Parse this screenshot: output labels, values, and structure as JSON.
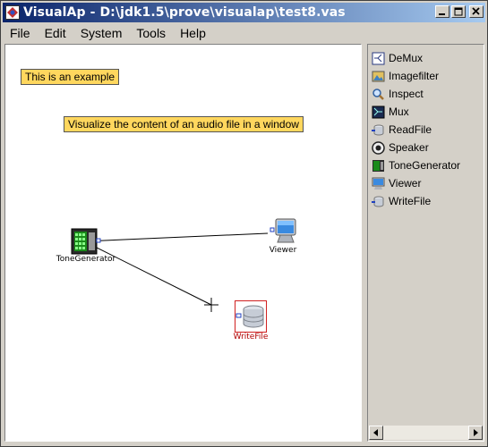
{
  "window": {
    "title": "VisualAp - D:\\jdk1.5\\prove\\visualap\\test8.vas",
    "buttons": {
      "minimize": "_",
      "maximize": "□",
      "close": "×"
    }
  },
  "menu": [
    "File",
    "Edit",
    "System",
    "Tools",
    "Help"
  ],
  "canvas": {
    "notes": [
      {
        "text": "This is an example"
      },
      {
        "text": "Visualize the content of an audio file in a window"
      }
    ],
    "nodes": {
      "tone_generator": {
        "label": "ToneGenerator",
        "icon": "tone-generator-icon"
      },
      "viewer": {
        "label": "Viewer",
        "icon": "monitor-icon"
      },
      "write_file": {
        "label": "WriteFile",
        "icon": "database-icon",
        "selected": true,
        "label_color": "#b00000"
      }
    },
    "connections": [
      {
        "from": "ToneGenerator",
        "to": "Viewer"
      },
      {
        "from": "ToneGenerator",
        "to": "(pending)"
      }
    ]
  },
  "palette": {
    "items": [
      {
        "label": "DeMux",
        "icon": "demux-icon"
      },
      {
        "label": "Imagefilter",
        "icon": "imagefilter-icon"
      },
      {
        "label": "Inspect",
        "icon": "magnifier-icon"
      },
      {
        "label": "Mux",
        "icon": "mux-icon"
      },
      {
        "label": "ReadFile",
        "icon": "database-read-icon"
      },
      {
        "label": "Speaker",
        "icon": "speaker-icon"
      },
      {
        "label": "ToneGenerator",
        "icon": "tone-generator-icon"
      },
      {
        "label": "Viewer",
        "icon": "monitor-icon"
      },
      {
        "label": "WriteFile",
        "icon": "database-write-icon"
      }
    ]
  },
  "colors": {
    "titlebar_start": "#0a246a",
    "titlebar_end": "#a6caf0",
    "note_bg": "#ffd75e",
    "selection": "#d02020"
  }
}
